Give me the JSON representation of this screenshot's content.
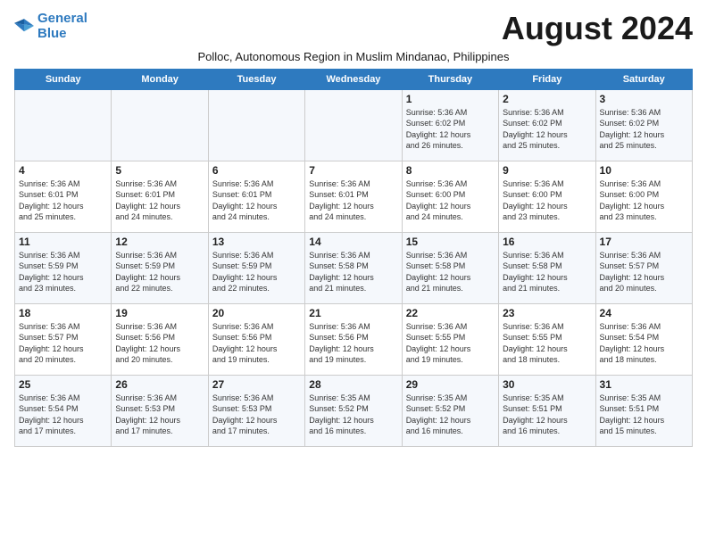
{
  "logo": {
    "line1": "General",
    "line2": "Blue"
  },
  "title": "August 2024",
  "subtitle": "Polloc, Autonomous Region in Muslim Mindanao, Philippines",
  "headers": [
    "Sunday",
    "Monday",
    "Tuesday",
    "Wednesday",
    "Thursday",
    "Friday",
    "Saturday"
  ],
  "weeks": [
    [
      {
        "day": "",
        "info": ""
      },
      {
        "day": "",
        "info": ""
      },
      {
        "day": "",
        "info": ""
      },
      {
        "day": "",
        "info": ""
      },
      {
        "day": "1",
        "info": "Sunrise: 5:36 AM\nSunset: 6:02 PM\nDaylight: 12 hours\nand 26 minutes."
      },
      {
        "day": "2",
        "info": "Sunrise: 5:36 AM\nSunset: 6:02 PM\nDaylight: 12 hours\nand 25 minutes."
      },
      {
        "day": "3",
        "info": "Sunrise: 5:36 AM\nSunset: 6:02 PM\nDaylight: 12 hours\nand 25 minutes."
      }
    ],
    [
      {
        "day": "4",
        "info": "Sunrise: 5:36 AM\nSunset: 6:01 PM\nDaylight: 12 hours\nand 25 minutes."
      },
      {
        "day": "5",
        "info": "Sunrise: 5:36 AM\nSunset: 6:01 PM\nDaylight: 12 hours\nand 24 minutes."
      },
      {
        "day": "6",
        "info": "Sunrise: 5:36 AM\nSunset: 6:01 PM\nDaylight: 12 hours\nand 24 minutes."
      },
      {
        "day": "7",
        "info": "Sunrise: 5:36 AM\nSunset: 6:01 PM\nDaylight: 12 hours\nand 24 minutes."
      },
      {
        "day": "8",
        "info": "Sunrise: 5:36 AM\nSunset: 6:00 PM\nDaylight: 12 hours\nand 24 minutes."
      },
      {
        "day": "9",
        "info": "Sunrise: 5:36 AM\nSunset: 6:00 PM\nDaylight: 12 hours\nand 23 minutes."
      },
      {
        "day": "10",
        "info": "Sunrise: 5:36 AM\nSunset: 6:00 PM\nDaylight: 12 hours\nand 23 minutes."
      }
    ],
    [
      {
        "day": "11",
        "info": "Sunrise: 5:36 AM\nSunset: 5:59 PM\nDaylight: 12 hours\nand 23 minutes."
      },
      {
        "day": "12",
        "info": "Sunrise: 5:36 AM\nSunset: 5:59 PM\nDaylight: 12 hours\nand 22 minutes."
      },
      {
        "day": "13",
        "info": "Sunrise: 5:36 AM\nSunset: 5:59 PM\nDaylight: 12 hours\nand 22 minutes."
      },
      {
        "day": "14",
        "info": "Sunrise: 5:36 AM\nSunset: 5:58 PM\nDaylight: 12 hours\nand 21 minutes."
      },
      {
        "day": "15",
        "info": "Sunrise: 5:36 AM\nSunset: 5:58 PM\nDaylight: 12 hours\nand 21 minutes."
      },
      {
        "day": "16",
        "info": "Sunrise: 5:36 AM\nSunset: 5:58 PM\nDaylight: 12 hours\nand 21 minutes."
      },
      {
        "day": "17",
        "info": "Sunrise: 5:36 AM\nSunset: 5:57 PM\nDaylight: 12 hours\nand 20 minutes."
      }
    ],
    [
      {
        "day": "18",
        "info": "Sunrise: 5:36 AM\nSunset: 5:57 PM\nDaylight: 12 hours\nand 20 minutes."
      },
      {
        "day": "19",
        "info": "Sunrise: 5:36 AM\nSunset: 5:56 PM\nDaylight: 12 hours\nand 20 minutes."
      },
      {
        "day": "20",
        "info": "Sunrise: 5:36 AM\nSunset: 5:56 PM\nDaylight: 12 hours\nand 19 minutes."
      },
      {
        "day": "21",
        "info": "Sunrise: 5:36 AM\nSunset: 5:56 PM\nDaylight: 12 hours\nand 19 minutes."
      },
      {
        "day": "22",
        "info": "Sunrise: 5:36 AM\nSunset: 5:55 PM\nDaylight: 12 hours\nand 19 minutes."
      },
      {
        "day": "23",
        "info": "Sunrise: 5:36 AM\nSunset: 5:55 PM\nDaylight: 12 hours\nand 18 minutes."
      },
      {
        "day": "24",
        "info": "Sunrise: 5:36 AM\nSunset: 5:54 PM\nDaylight: 12 hours\nand 18 minutes."
      }
    ],
    [
      {
        "day": "25",
        "info": "Sunrise: 5:36 AM\nSunset: 5:54 PM\nDaylight: 12 hours\nand 17 minutes."
      },
      {
        "day": "26",
        "info": "Sunrise: 5:36 AM\nSunset: 5:53 PM\nDaylight: 12 hours\nand 17 minutes."
      },
      {
        "day": "27",
        "info": "Sunrise: 5:36 AM\nSunset: 5:53 PM\nDaylight: 12 hours\nand 17 minutes."
      },
      {
        "day": "28",
        "info": "Sunrise: 5:35 AM\nSunset: 5:52 PM\nDaylight: 12 hours\nand 16 minutes."
      },
      {
        "day": "29",
        "info": "Sunrise: 5:35 AM\nSunset: 5:52 PM\nDaylight: 12 hours\nand 16 minutes."
      },
      {
        "day": "30",
        "info": "Sunrise: 5:35 AM\nSunset: 5:51 PM\nDaylight: 12 hours\nand 16 minutes."
      },
      {
        "day": "31",
        "info": "Sunrise: 5:35 AM\nSunset: 5:51 PM\nDaylight: 12 hours\nand 15 minutes."
      }
    ]
  ]
}
